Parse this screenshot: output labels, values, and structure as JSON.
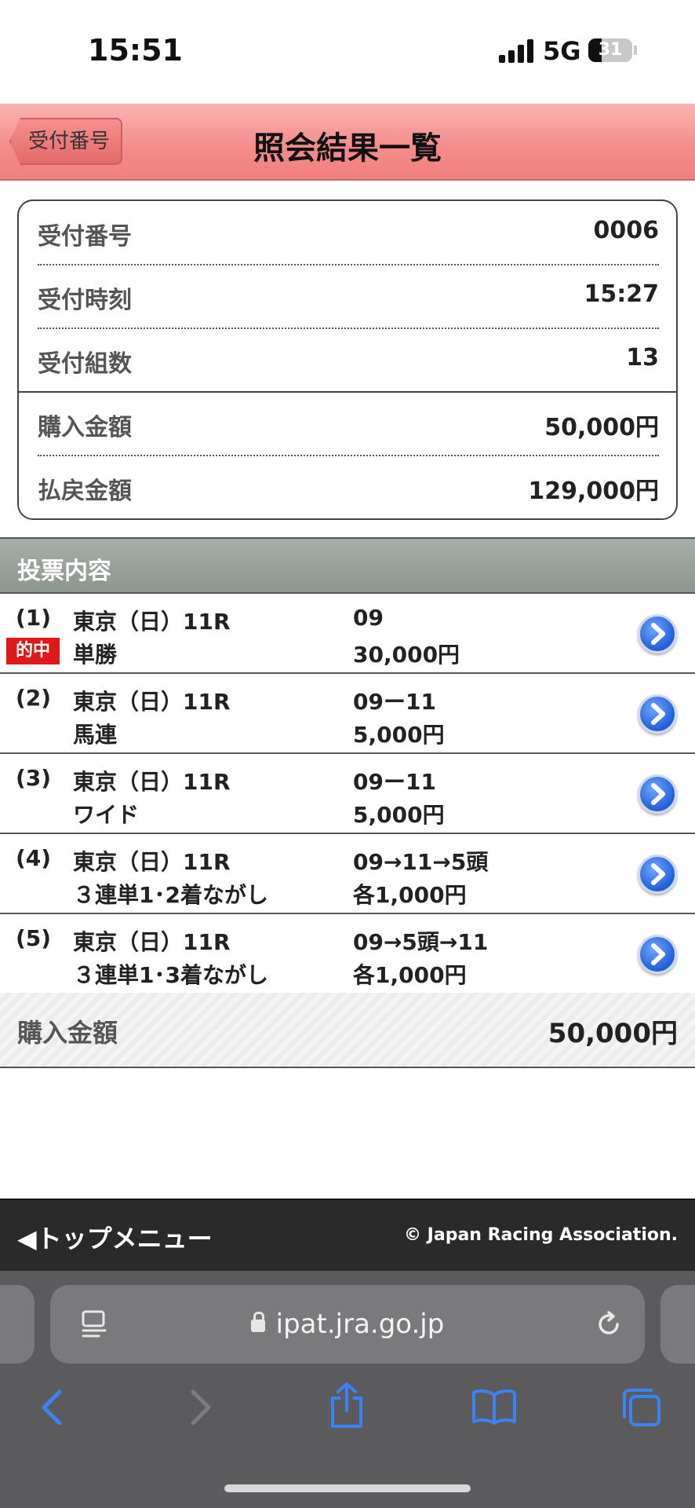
{
  "status_bar": {
    "time": "15:51",
    "network": "5G",
    "battery": "31",
    "battery_level": 0.31
  },
  "header": {
    "back_label": "受付番号",
    "title": "照会結果一覧"
  },
  "receipt": {
    "number_label": "受付番号",
    "number_value": "0006",
    "time_label": "受付時刻",
    "time_value": "15:27",
    "sets_label": "受付組数",
    "sets_value": "13",
    "purchase_label": "購入金額",
    "purchase_value": "50,000円",
    "payout_label": "払戻金額",
    "payout_value": "129,000円"
  },
  "bets_section": {
    "title": "投票内容",
    "hit_badge": "的中",
    "items": [
      {
        "num": "(1)",
        "race": "東京（日）11R",
        "type": "単勝",
        "combo": "09",
        "amount": "30,000円",
        "hit": true
      },
      {
        "num": "(2)",
        "race": "東京（日）11R",
        "type": "馬連",
        "combo": "09ー11",
        "amount": "5,000円",
        "hit": false
      },
      {
        "num": "(3)",
        "race": "東京（日）11R",
        "type": "ワイド",
        "combo": "09ー11",
        "amount": "5,000円",
        "hit": false
      },
      {
        "num": "(4)",
        "race": "東京（日）11R",
        "type": "３連単1･2着ながし",
        "combo": "09→11→5頭",
        "amount": "各1,000円",
        "hit": false
      },
      {
        "num": "(5)",
        "race": "東京（日）11R",
        "type": "３連単1･3着ながし",
        "combo": "09→5頭→11",
        "amount": "各1,000円",
        "hit": false
      }
    ]
  },
  "total": {
    "label": "購入金額",
    "value": "50,000円"
  },
  "footer": {
    "top_menu": "トップメニュー",
    "copyright": "© Japan Racing Association."
  },
  "browser": {
    "url": "ipat.jra.go.jp",
    "icons": [
      "reader-icon",
      "lock-icon",
      "reload-icon",
      "back-arrow-icon",
      "forward-arrow-icon",
      "share-icon",
      "bookmarks-icon",
      "tabs-icon"
    ],
    "accent_color": "#3b82f6"
  }
}
